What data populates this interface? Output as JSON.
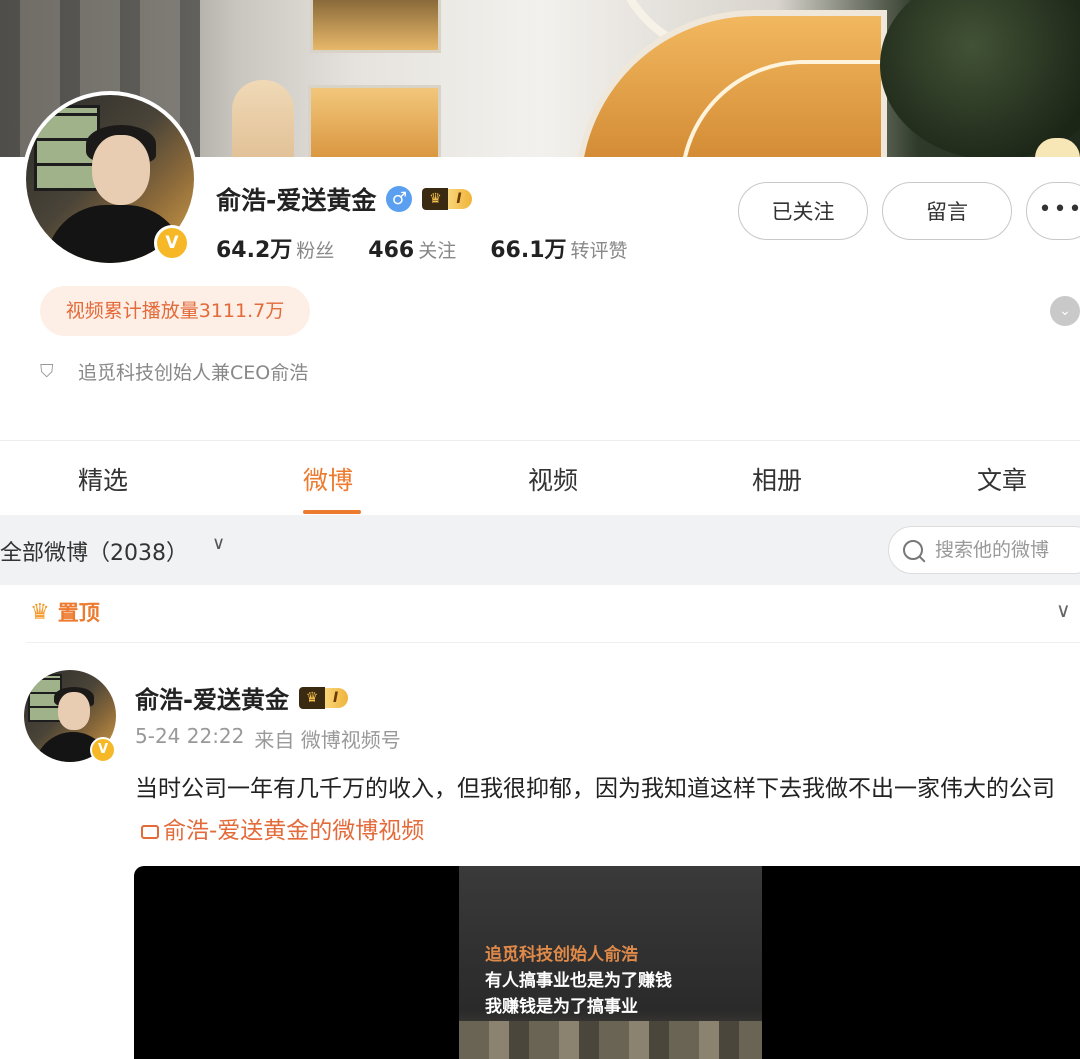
{
  "profile": {
    "name": "俞浩-爱送黄金",
    "gender_symbol": "♂",
    "vip_level": "I",
    "verified_mark": "V",
    "stats": [
      {
        "num": "64.2万",
        "label": "粉丝"
      },
      {
        "num": "466",
        "label": "关注"
      },
      {
        "num": "66.1万",
        "label": "转评赞"
      }
    ],
    "follow_label": "已关注",
    "message_label": "留言",
    "more_label": "•••",
    "play_count": "视频累计播放量3111.7万",
    "certification": "追觅科技创始人兼CEO俞浩"
  },
  "tabs": [
    "精选",
    "微博",
    "视频",
    "相册",
    "文章"
  ],
  "active_tab": "微博",
  "filter": {
    "label": "全部微博（2038）",
    "search_placeholder": "搜索他的微博"
  },
  "pinned_label": "置顶",
  "post": {
    "author": "俞浩-爱送黄金",
    "vip_level": "I",
    "time": "5-24 22:22",
    "source": "来自 微博视频号",
    "text": "当时公司一年有几千万的收入，但我很抑郁，因为我知道这样下去我做不出一家伟大的公司",
    "link_text": "俞浩-爱送黄金的微博视频",
    "video_caption_1": "追觅科技创始人俞浩",
    "video_caption_2": "有人搞事业也是为了赚钱",
    "video_caption_3": "我赚钱是为了搞事业"
  },
  "icons": {
    "crown": "crown-icon",
    "shield": "shield-icon",
    "search": "search-icon",
    "chevron": "chevron-down-icon"
  },
  "colors": {
    "accent": "#ed7b2f",
    "link": "#e36a39",
    "verified": "#f6b827",
    "gender": "#5a9ff0"
  }
}
